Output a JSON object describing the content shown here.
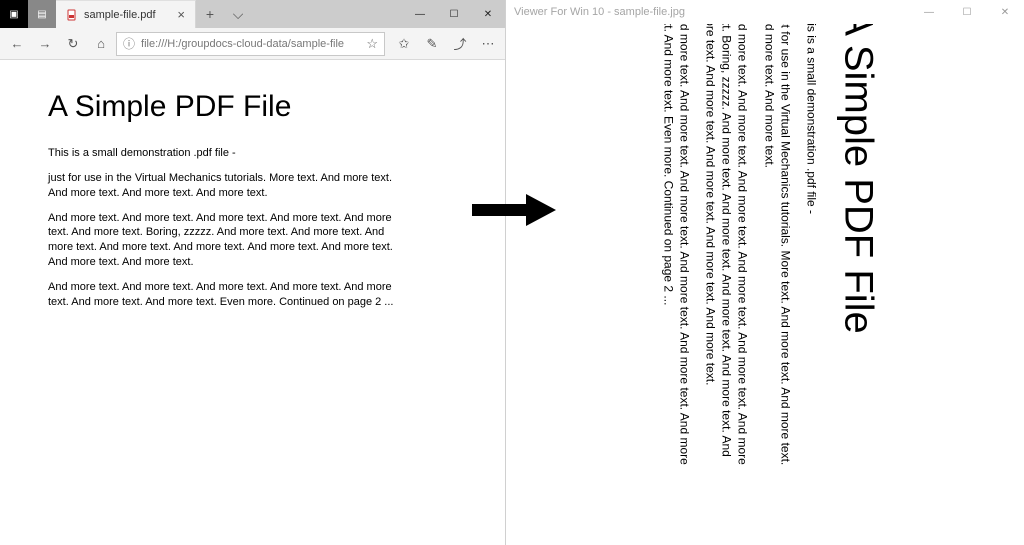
{
  "browser": {
    "tab_title": "sample-file.pdf",
    "url": "file:///H:/groupdocs-cloud-data/sample-file",
    "url_prefix": "ⓘ"
  },
  "viewer": {
    "title": "Viewer For Win 10 - sample-file.jpg"
  },
  "doc": {
    "title": "A Simple PDF File",
    "p1": "This is a small demonstration .pdf file -",
    "p2": "just for use in the Virtual Mechanics tutorials. More text. And more text. And more text. And more text. And more text.",
    "p3": "And more text. And more text. And more text. And more text. And more text. And more text. Boring, zzzzz. And more text. And more text. And more text. And more text. And more text. And more text. And more text. And more text. And more text.",
    "p4": "And more text. And more text. And more text. And more text. And more text. And more text. And more text. Even more. Continued on page 2 ..."
  }
}
